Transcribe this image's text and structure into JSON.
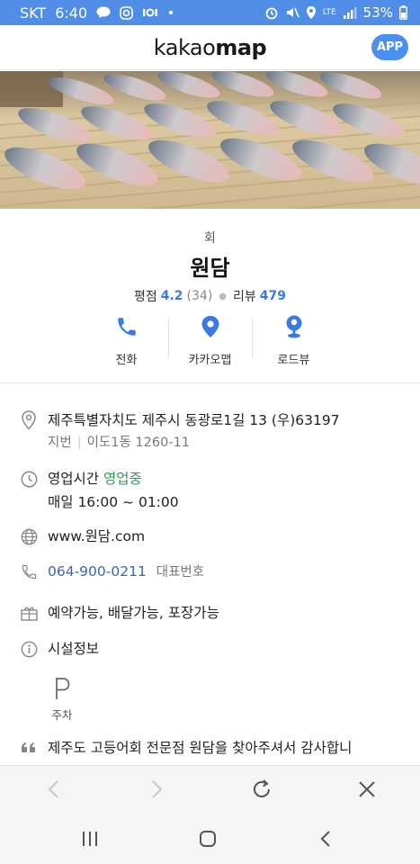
{
  "status_bar": {
    "carrier": "SKT",
    "time": "6:40",
    "battery": "53%",
    "network": "LTE"
  },
  "header": {
    "logo_part1": "kakao",
    "logo_part2": "map",
    "app_button": "APP"
  },
  "place": {
    "category": "회",
    "name": "원담",
    "rating_label": "평점",
    "rating": "4.2",
    "rating_count": "(34)",
    "review_label": "리뷰",
    "review_count": "479"
  },
  "actions": [
    {
      "label": "전화",
      "icon": "phone-icon"
    },
    {
      "label": "카카오맵",
      "icon": "map-pin-icon"
    },
    {
      "label": "로드뷰",
      "icon": "roadview-icon"
    }
  ],
  "details": {
    "address": "제주특별자치도 제주시 동광로1길 13 (우)63197",
    "jibun_label": "지번",
    "jibun": "이도1동 1260-11",
    "hours_label": "영업시간",
    "hours_status": "영업중",
    "hours": "매일 16:00 ~ 01:00",
    "website": "www.원담.com",
    "phone": "064-900-0211",
    "phone_type": "대표번호",
    "services": "예약가능, 배달가능, 포장가능",
    "facility_label": "시설정보",
    "parking_label": "주차",
    "intro": "제주도 고등어회 전문점 원담을 찾아주셔서 감사합니"
  },
  "colors": {
    "status_bar": "#4f8de6",
    "accent_blue": "#3a7be0",
    "open_green": "#2d9b58",
    "link": "#3866b8"
  }
}
